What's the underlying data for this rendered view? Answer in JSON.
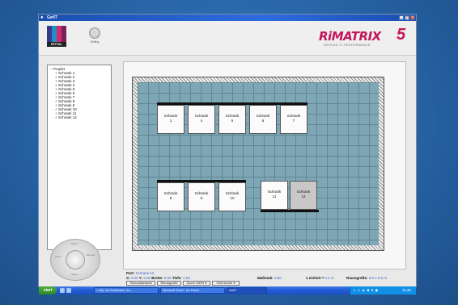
{
  "window": {
    "title": "GetIT",
    "buttons": [
      "_",
      "□",
      "×"
    ]
  },
  "header": {
    "logo_text": "RITTAL",
    "logo_colors": [
      "#3a3a8c",
      "#1e90c8",
      "#d02a6a",
      "#7a1f5c"
    ],
    "gear_label": "Setting",
    "brand_name": "RiMATRIX",
    "brand_version": "5",
    "brand_tagline": "DRIVING IT-PERFORMANCE",
    "brand_color": "#c2185b"
  },
  "tree": {
    "root": "Projekt",
    "items": [
      "Schrank 1",
      "Schrank 2",
      "Schrank 3",
      "Schrank 4",
      "Schrank 5",
      "Schrank 6",
      "Schrank 7",
      "Schrank 8",
      "Schrank 9",
      "Schrank 10",
      "Schrank 11",
      "Schrank 12"
    ]
  },
  "dial": {
    "segments": [
      "Zoom",
      "Raum",
      "Schrank",
      "Setup"
    ]
  },
  "room": {
    "rows": [
      {
        "cabinets": [
          {
            "line1": "Schrank",
            "line2": "1"
          },
          {
            "line1": "Schrank",
            "line2": "4"
          },
          {
            "line1": "Schrank",
            "line2": "5"
          },
          {
            "line1": "Schrank",
            "line2": "6"
          },
          {
            "line1": "Schrank",
            "line2": "7"
          }
        ]
      },
      {
        "cabinets": [
          {
            "line1": "Schrank",
            "line2": "8"
          },
          {
            "line1": "Schrank",
            "line2": "9"
          },
          {
            "line1": "Schrank",
            "line2": "10"
          },
          {
            "line1": "Schrank",
            "line2": "11"
          },
          {
            "line1": "Schrank",
            "line2": "12",
            "selected": true
          }
        ]
      }
    ]
  },
  "status": {
    "part_label": "Part:",
    "part_value": "Schrank 12",
    "x_label": "X:",
    "x_value": "3.00",
    "y_label": "Y:",
    "y_value": "2.00",
    "breite_label": "Breite:",
    "breite_value": "0.60",
    "tiefe_label": "Tiefe:",
    "tiefe_value": "1.00",
    "mass_label": "Maßstab:",
    "mass_value": "1:50",
    "einheit_label": "1 einheit =",
    "einheit_value": "0.1 m",
    "raumgr_label": "Raumgröße:",
    "raumgr_value": "9.6 x 6.0 m",
    "toolbar": [
      "Schrankansicht",
      "Raumgröße",
      "Zoom 100%",
      "Grid dunne"
    ]
  },
  "taskbar": {
    "start_label": "start",
    "tasks": [
      "> MQ. Ari Partitioden, Arr...",
      "Microsoft Excel - Arr Facht...",
      "GetIT"
    ],
    "clock": "11:46"
  }
}
